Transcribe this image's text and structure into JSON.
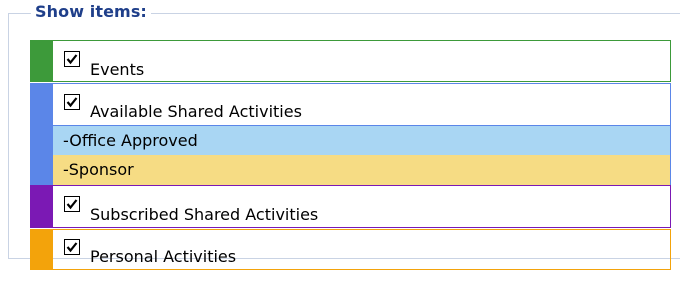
{
  "legend": "Show items:",
  "colors": {
    "events": "#3d9a3a",
    "available": "#5b86e8",
    "subscribed": "#7b19b4",
    "personal": "#f3a30b",
    "office_approved_bg": "#a9d6f3",
    "sponsor_bg": "#f6dc84",
    "border": "#c9d3e4"
  },
  "items": [
    {
      "label": "Events",
      "checked": true
    },
    {
      "label": "Available Shared Activities",
      "checked": true
    },
    {
      "label": "Subscribed Shared Activities",
      "checked": true
    },
    {
      "label": "Personal Activities",
      "checked": true
    }
  ],
  "subitems": [
    {
      "label": "-Office Approved"
    },
    {
      "label": "-Sponsor"
    }
  ]
}
